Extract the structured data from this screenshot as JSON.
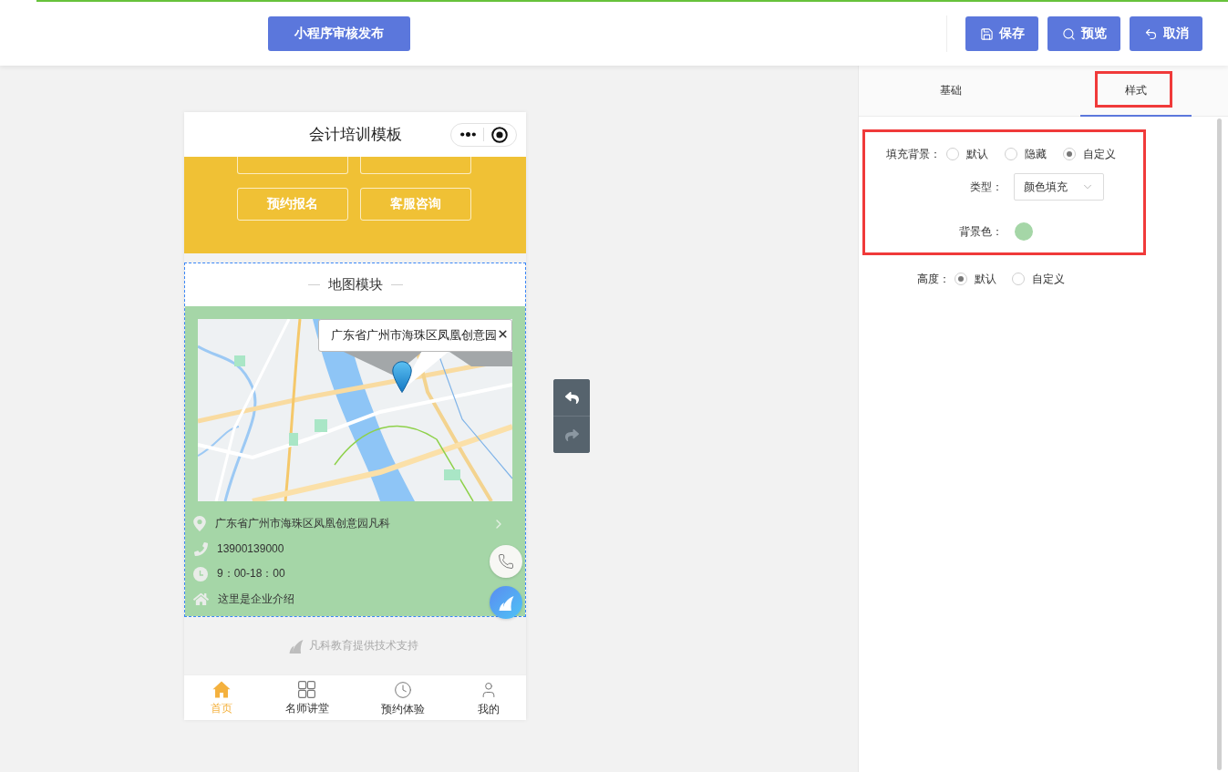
{
  "top_bar": {
    "publish_button": "小程序审核发布",
    "actions": [
      {
        "kind": "save",
        "label": "保存"
      },
      {
        "kind": "preview",
        "label": "预览"
      },
      {
        "kind": "cancel",
        "label": "取消"
      }
    ]
  },
  "phone": {
    "title": "会计培训模板",
    "quick_buttons": [
      {
        "kind": "clipped"
      },
      {
        "kind": "clipped"
      },
      {
        "kind": "button",
        "label": "预约报名"
      },
      {
        "kind": "button",
        "label": "客服咨询"
      }
    ],
    "map_module": {
      "title": "地图模块",
      "selected": true,
      "popup": "广东省广州市海珠区凤凰创意园",
      "info_rows": [
        {
          "kind": "address",
          "text": "广东省广州市海珠区凤凰创意园凡科",
          "linked": true
        },
        {
          "kind": "phone",
          "text": "13900139000",
          "linked": false
        },
        {
          "kind": "hours",
          "text": "9：00-18：00",
          "linked": false
        },
        {
          "kind": "intro",
          "text": "这里是企业介绍",
          "linked": false
        }
      ]
    },
    "footer": "凡科教育提供技术支持",
    "tab_bar": [
      {
        "kind": "home",
        "label": "首页",
        "selected": true
      },
      {
        "kind": "grid",
        "label": "名师讲堂",
        "selected": false
      },
      {
        "kind": "clock",
        "label": "预约体验",
        "selected": false
      },
      {
        "kind": "user",
        "label": "我的",
        "selected": false
      }
    ]
  },
  "history_buttons": [
    {
      "kind": "undo",
      "disabled": false
    },
    {
      "kind": "redo",
      "disabled": true
    }
  ],
  "settings_panel": {
    "tabs": [
      {
        "label": "基础",
        "selected": false,
        "highlighted": false
      },
      {
        "label": "样式",
        "selected": true,
        "highlighted": true
      }
    ],
    "fill_background": {
      "label": "填充背景：",
      "highlighted": true,
      "options": [
        {
          "label": "默认",
          "selected": false
        },
        {
          "label": "隐藏",
          "selected": false
        },
        {
          "label": "自定义",
          "selected": true
        }
      ],
      "type": {
        "label": "类型：",
        "value": "颜色填充"
      },
      "background_color": {
        "label": "背景色：",
        "color": "#a5d6a7"
      }
    },
    "height": {
      "label": "高度：",
      "options": [
        {
          "label": "默认",
          "selected": true
        },
        {
          "label": "自定义",
          "selected": false
        }
      ]
    }
  }
}
